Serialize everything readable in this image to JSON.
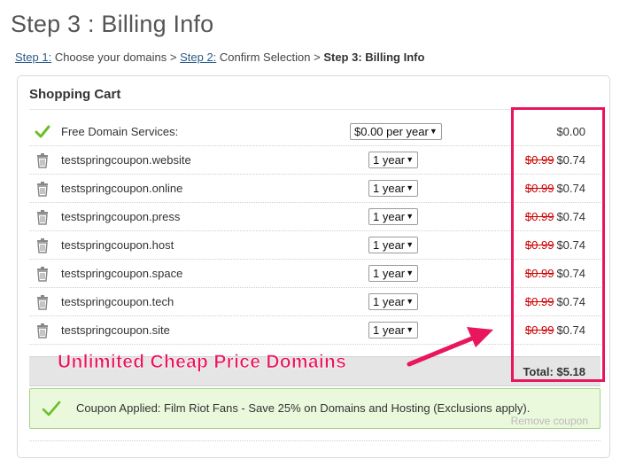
{
  "page": {
    "title": "Step 3 : Billing Info"
  },
  "breadcrumb": {
    "step1_link": "Step 1:",
    "step1_text": " Choose your domains > ",
    "step2_link": "Step 2:",
    "step2_text": " Confirm Selection > ",
    "current": "Step 3: Billing Info"
  },
  "cart": {
    "title": "Shopping Cart",
    "items": [
      {
        "name": "Free Domain Services:",
        "term": "$0.00 per year",
        "old_price": "",
        "price": "$0.00",
        "icon": "check-icon"
      },
      {
        "name": "testspringcoupon.website",
        "term": "1 year",
        "old_price": "$0.99",
        "price": "$0.74",
        "icon": "trash-icon"
      },
      {
        "name": "testspringcoupon.online",
        "term": "1 year",
        "old_price": "$0.99",
        "price": "$0.74",
        "icon": "trash-icon"
      },
      {
        "name": "testspringcoupon.press",
        "term": "1 year",
        "old_price": "$0.99",
        "price": "$0.74",
        "icon": "trash-icon"
      },
      {
        "name": "testspringcoupon.host",
        "term": "1 year",
        "old_price": "$0.99",
        "price": "$0.74",
        "icon": "trash-icon"
      },
      {
        "name": "testspringcoupon.space",
        "term": "1 year",
        "old_price": "$0.99",
        "price": "$0.74",
        "icon": "trash-icon"
      },
      {
        "name": "testspringcoupon.tech",
        "term": "1 year",
        "old_price": "$0.99",
        "price": "$0.74",
        "icon": "trash-icon"
      },
      {
        "name": "testspringcoupon.site",
        "term": "1 year",
        "old_price": "$0.99",
        "price": "$0.74",
        "icon": "trash-icon"
      }
    ],
    "total": "Total: $5.18"
  },
  "coupon": {
    "text": "Coupon Applied: Film Riot Fans - Save 25% on Domains and Hosting (Exclusions apply).",
    "remove_label": "Remove coupon"
  },
  "annotation": {
    "text": "Unlimited Cheap Price Domains",
    "color": "#e8175d"
  },
  "colors": {
    "strike": "#cc0000",
    "coupon_bg": "#eaf8dc",
    "check": "#6abf2a"
  }
}
